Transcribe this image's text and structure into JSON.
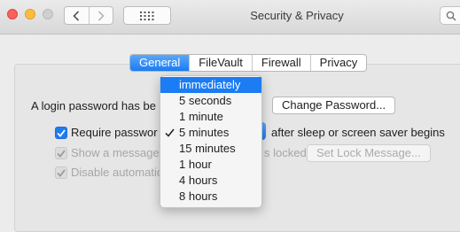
{
  "window": {
    "title": "Security & Privacy"
  },
  "tabs": [
    "General",
    "FileVault",
    "Firewall",
    "Privacy"
  ],
  "general": {
    "login_password_text": "A login password has be",
    "change_password_label": "Change Password...",
    "require_password_label": "Require passwor",
    "require_password_suffix": "after sleep or screen saver begins",
    "show_message_label": "Show a message",
    "show_message_suffix": "s locked",
    "set_lock_message_label": "Set Lock Message...",
    "disable_auto_label": "Disable automatic"
  },
  "password_delay_menu": {
    "selected": "5 minutes",
    "highlighted": "immediately",
    "options": [
      "immediately",
      "5 seconds",
      "1 minute",
      "5 minutes",
      "15 minutes",
      "1 hour",
      "4 hours",
      "8 hours"
    ]
  },
  "colors": {
    "accent": "#1b7cf4",
    "window_background": "#ececec"
  },
  "icons": {
    "back": "chevron-left-icon",
    "forward": "chevron-right-icon",
    "show_all": "grid-icon",
    "search": "search-icon",
    "checkmark": "checkmark-icon"
  }
}
